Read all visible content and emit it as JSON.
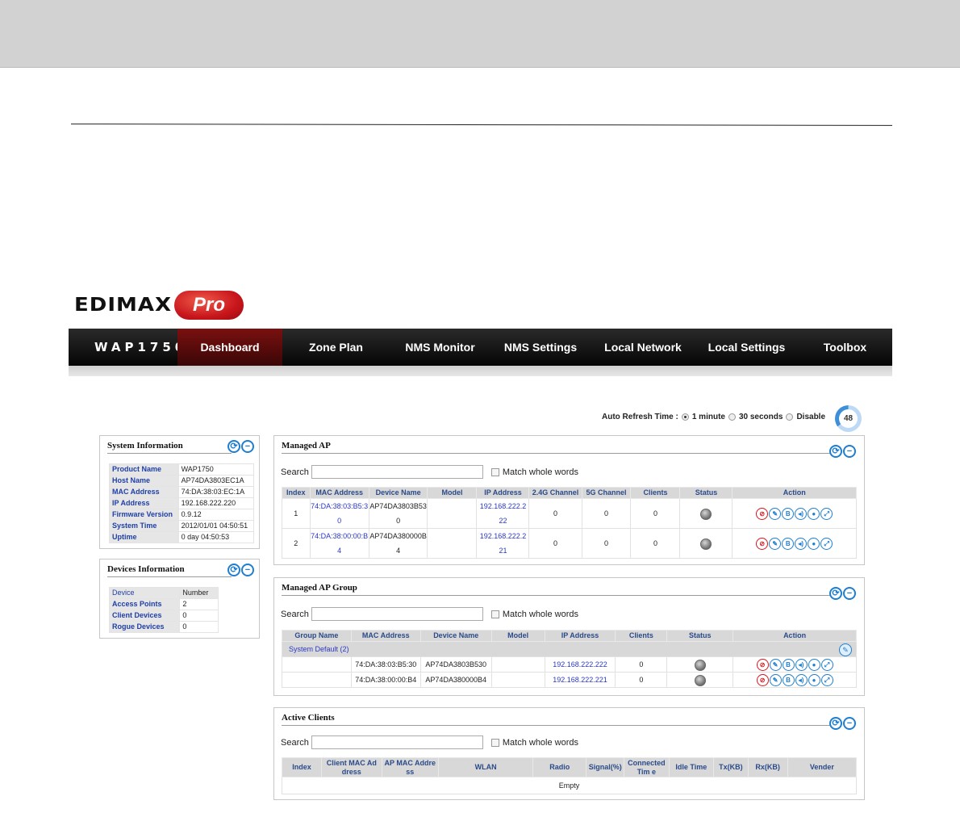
{
  "brand": {
    "word": "EDIMAX",
    "badge": "Pro"
  },
  "nav": {
    "model": "WAP1750",
    "items": [
      "Dashboard",
      "Zone Plan",
      "NMS Monitor",
      "NMS Settings",
      "Local Network",
      "Local Settings",
      "Toolbox"
    ],
    "active": "Dashboard"
  },
  "refresh": {
    "label": "Auto Refresh Time :",
    "options": [
      "1 minute",
      "30 seconds",
      "Disable"
    ],
    "selected": "1 minute",
    "countdown": "48"
  },
  "system_info": {
    "title": "System Information",
    "rows": [
      {
        "k": "Product Name",
        "v": "WAP1750"
      },
      {
        "k": "Host Name",
        "v": "AP74DA3803EC1A"
      },
      {
        "k": "MAC Address",
        "v": "74:DA:38:03:EC:1A"
      },
      {
        "k": "IP Address",
        "v": "192.168.222.220"
      },
      {
        "k": "Firmware Version",
        "v": "0.9.12"
      },
      {
        "k": "System Time",
        "v": "2012/01/01 04:50:51"
      },
      {
        "k": "Uptime",
        "v": "0 day 04:50:53"
      }
    ]
  },
  "devices_info": {
    "title": "Devices Information",
    "headers": [
      "Device",
      "Number"
    ],
    "rows": [
      {
        "k": "Access Points",
        "v": "2"
      },
      {
        "k": "Client Devices",
        "v": "0"
      },
      {
        "k": "Rogue Devices",
        "v": "0"
      }
    ]
  },
  "managed_ap": {
    "title": "Managed AP",
    "search_label": "Search",
    "match_label": "Match whole words",
    "headers": [
      "Index",
      "MAC Address",
      "Device Name",
      "Model",
      "IP Address",
      "2.4G Channel",
      "5G Channel",
      "Clients",
      "Status",
      "Action"
    ],
    "rows": [
      {
        "index": "1",
        "mac1": "74:DA:38:03:B5:3",
        "mac2": "0",
        "name1": "AP74DA3803B53",
        "name2": "0",
        "model": "",
        "ip1": "192.168.222.2",
        "ip2": "22",
        "ch24": "0",
        "ch5": "0",
        "clients": "0"
      },
      {
        "index": "2",
        "mac1": "74:DA:38:00:00:B",
        "mac2": "4",
        "name1": "AP74DA380000B",
        "name2": "4",
        "model": "",
        "ip1": "192.168.222.2",
        "ip2": "21",
        "ch24": "0",
        "ch5": "0",
        "clients": "0"
      }
    ]
  },
  "managed_ap_group": {
    "title": "Managed AP Group",
    "search_label": "Search",
    "match_label": "Match whole words",
    "headers": [
      "Group Name",
      "MAC Address",
      "Device Name",
      "Model",
      "IP Address",
      "Clients",
      "Status",
      "Action"
    ],
    "group_row": "System Default (2)",
    "rows": [
      {
        "mac": "74:DA:38:03:B5:30",
        "name": "AP74DA3803B530",
        "model": "",
        "ip": "192.168.222.222",
        "clients": "0"
      },
      {
        "mac": "74:DA:38:00:00:B4",
        "name": "AP74DA380000B4",
        "model": "",
        "ip": "192.168.222.221",
        "clients": "0"
      }
    ]
  },
  "active_clients": {
    "title": "Active Clients",
    "search_label": "Search",
    "match_label": "Match whole words",
    "headers": [
      "Index",
      "Client MAC Ad dress",
      "AP MAC Addre ss",
      "WLAN",
      "Radio",
      "Signal(%)",
      "Connected Tim e",
      "Idle Time",
      "Tx(KB)",
      "Rx(KB)",
      "Vender"
    ],
    "empty": "Empty"
  },
  "icons": {
    "refresh": "refresh-icon",
    "collapse": "collapse-icon",
    "actions": [
      "block-icon",
      "edit-icon",
      "reboot-icon",
      "locate-icon",
      "chat-icon",
      "link-icon"
    ]
  },
  "colors": {
    "nav_active": "#7a1010",
    "accent": "#1f7ed0",
    "link": "#2a38c6",
    "danger": "#d9161c"
  }
}
